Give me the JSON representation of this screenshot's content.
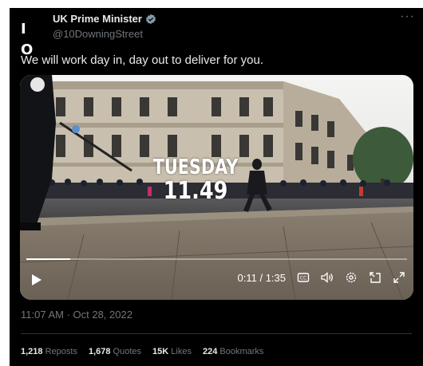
{
  "author": {
    "avatar_text": "I O",
    "name": "UK Prime Minister",
    "handle": "@10DowningStreet",
    "verified_icon": "verified-badge-icon"
  },
  "more_label": "···",
  "tweet": {
    "text": "We will work day in, day out to deliver for you."
  },
  "video": {
    "overlay_day": "TUESDAY",
    "overlay_time": "11.49",
    "time_display": "0:11 / 1:35",
    "progress": 0.116,
    "icons": [
      "play-icon",
      "captions-icon",
      "volume-icon",
      "settings-icon",
      "pip-icon",
      "fullscreen-icon"
    ]
  },
  "timestamp": "11:07 AM · Oct 28, 2022",
  "stats": {
    "reposts_count": "1,218",
    "reposts_label": "Reposts",
    "quotes_count": "1,678",
    "quotes_label": "Quotes",
    "likes_count": "15K",
    "likes_label": "Likes",
    "bookmarks_count": "224",
    "bookmarks_label": "Bookmarks"
  },
  "colors": {
    "background": "#000000",
    "primary_text": "#e7e9ea",
    "secondary_text": "#71767b",
    "verified": "#829aab",
    "divider": "#2f3336"
  }
}
